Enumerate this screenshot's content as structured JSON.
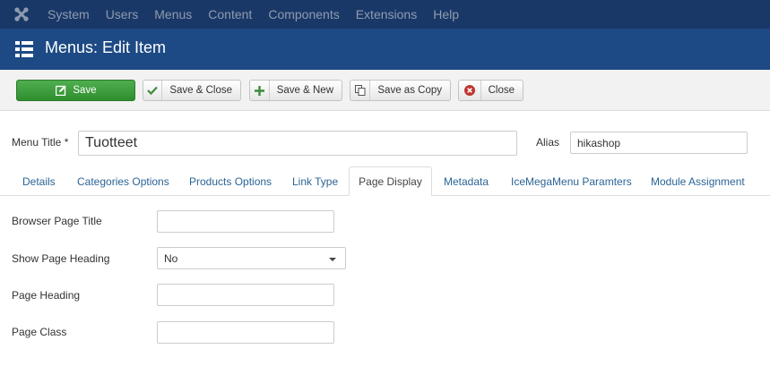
{
  "navbar": {
    "logo_icon": "joomla-logo-icon",
    "menu": [
      "System",
      "Users",
      "Menus",
      "Content",
      "Components",
      "Extensions",
      "Help"
    ]
  },
  "titlebar": {
    "icon": "list-grid-icon",
    "title": "Menus: Edit Item"
  },
  "toolbar": {
    "save": "Save",
    "save_close": "Save & Close",
    "save_new": "Save & New",
    "save_copy": "Save as Copy",
    "close": "Close"
  },
  "form": {
    "menu_title_label": "Menu Title *",
    "menu_title_value": "Tuotteet",
    "alias_label": "Alias",
    "alias_value": "hikashop"
  },
  "tabs": [
    "Details",
    "Categories Options",
    "Products Options",
    "Link Type",
    "Page Display",
    "Metadata",
    "IceMegaMenu Paramters",
    "Module Assignment"
  ],
  "active_tab": "Page Display",
  "page_display": {
    "browser_page_title_label": "Browser Page Title",
    "browser_page_title_value": "",
    "show_page_heading_label": "Show Page Heading",
    "show_page_heading_value": "No",
    "page_heading_label": "Page Heading",
    "page_heading_value": "",
    "page_class_label": "Page Class",
    "page_class_value": ""
  },
  "colors": {
    "navbar_bg": "#1a3867",
    "titlebar_bg": "#1d4a84",
    "save_green": "#3d9c3d",
    "link_blue": "#2a6496",
    "close_red": "#bd362f"
  }
}
